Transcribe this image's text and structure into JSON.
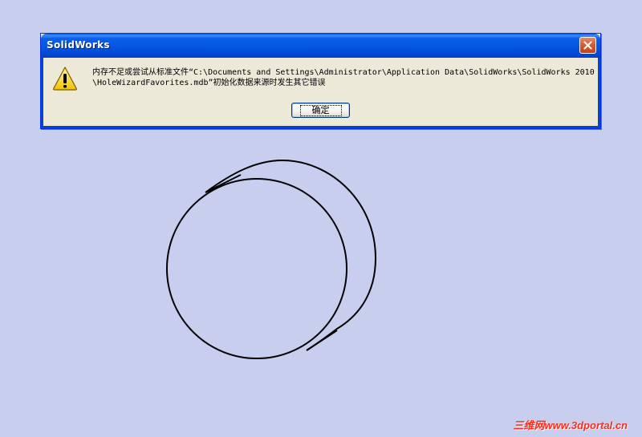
{
  "dialog": {
    "title": "SolidWorks",
    "message": "内存不足或尝试从标准文件“C:\\Documents and Settings\\Administrator\\Application Data\\SolidWorks\\SolidWorks 2010\\HoleWizardFavorites.mdb”初始化数据来源时发生其它错误",
    "ok_label": "确定",
    "icon": "warning-icon"
  },
  "watermark": {
    "text": "三维网www.3dportal.cn"
  },
  "colors": {
    "background": "#c8cfee",
    "titlebar": "#0054e3",
    "dialog_body": "#ece9d8",
    "close_button": "#d85a36",
    "watermark": "#ff2a1a"
  }
}
